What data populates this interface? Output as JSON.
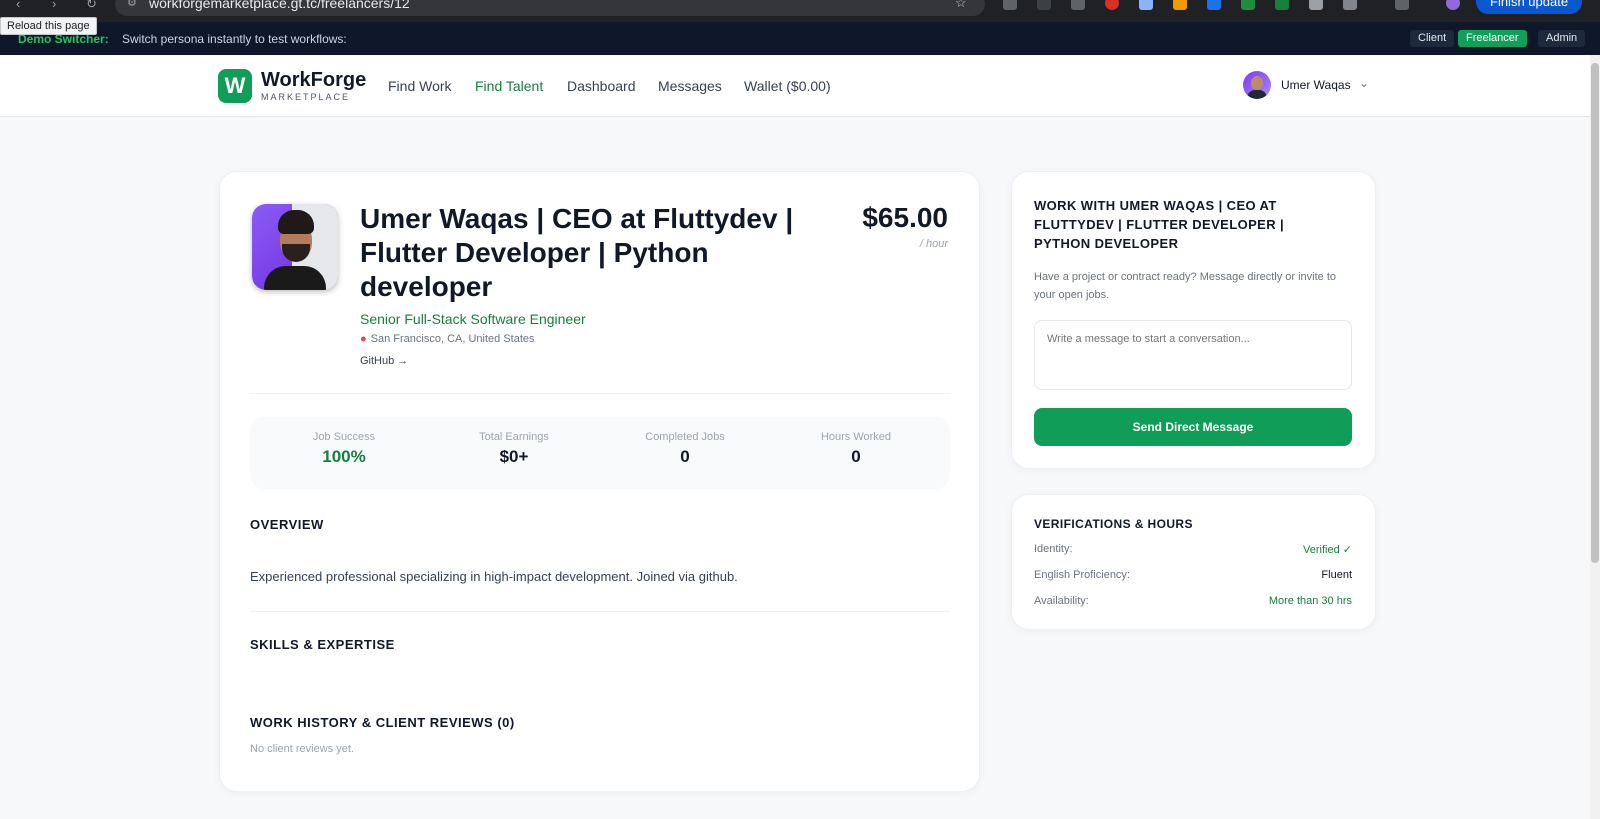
{
  "browser": {
    "url": "workforgemarketplace.gt.tc/freelancers/12",
    "tooltip": "Reload this page",
    "update_label": "Finish update"
  },
  "demo": {
    "label": "Demo Switcher:",
    "description": "Switch persona instantly to test workflows:",
    "personas": [
      "Client",
      "Freelancer",
      "Admin"
    ],
    "active_persona": "Freelancer"
  },
  "nav": {
    "logo_letter": "W",
    "brand": "WorkForge",
    "brand_sub": "MARKETPLACE",
    "links": [
      "Find Work",
      "Find Talent",
      "Dashboard",
      "Messages",
      "Wallet ($0.00)"
    ],
    "active_link": "Find Talent",
    "user_name": "Umer Waqas"
  },
  "profile": {
    "title": "Umer Waqas | CEO at Fluttydev | Flutter Developer | Python developer",
    "rate": "$65.00",
    "rate_unit": "/ hour",
    "role": "Senior Full-Stack Software Engineer",
    "location": "San Francisco, CA, United States",
    "github_link": "GitHub →"
  },
  "stats": [
    {
      "label": "Job Success",
      "value": "100%"
    },
    {
      "label": "Total Earnings",
      "value": "$0+"
    },
    {
      "label": "Completed Jobs",
      "value": "0"
    },
    {
      "label": "Hours Worked",
      "value": "0"
    }
  ],
  "sections": {
    "overview_title": "OVERVIEW",
    "overview_text": "Experienced professional specializing in high-impact development. Joined via github.",
    "skills_title": "SKILLS & EXPERTISE",
    "history_title": "WORK HISTORY & CLIENT REVIEWS (0)",
    "no_reviews": "No client reviews yet."
  },
  "contact": {
    "title": "WORK WITH UMER WAQAS | CEO AT FLUTTYDEV | FLUTTER DEVELOPER | PYTHON DEVELOPER",
    "description": "Have a project or contract ready? Message directly or invite to your open jobs.",
    "placeholder": "Write a message to start a conversation...",
    "button": "Send Direct Message"
  },
  "verifications": {
    "title": "VERIFICATIONS & HOURS",
    "rows": [
      {
        "label": "Identity:",
        "value": "Verified ✓"
      },
      {
        "label": "English Proficiency:",
        "value": "Fluent"
      },
      {
        "label": "Availability:",
        "value": "More than 30 hrs"
      }
    ]
  },
  "colors": {
    "brand_green": "#0f9d58",
    "accent_text_green": "#15803d",
    "demo_bar_bg": "#0f172a"
  }
}
